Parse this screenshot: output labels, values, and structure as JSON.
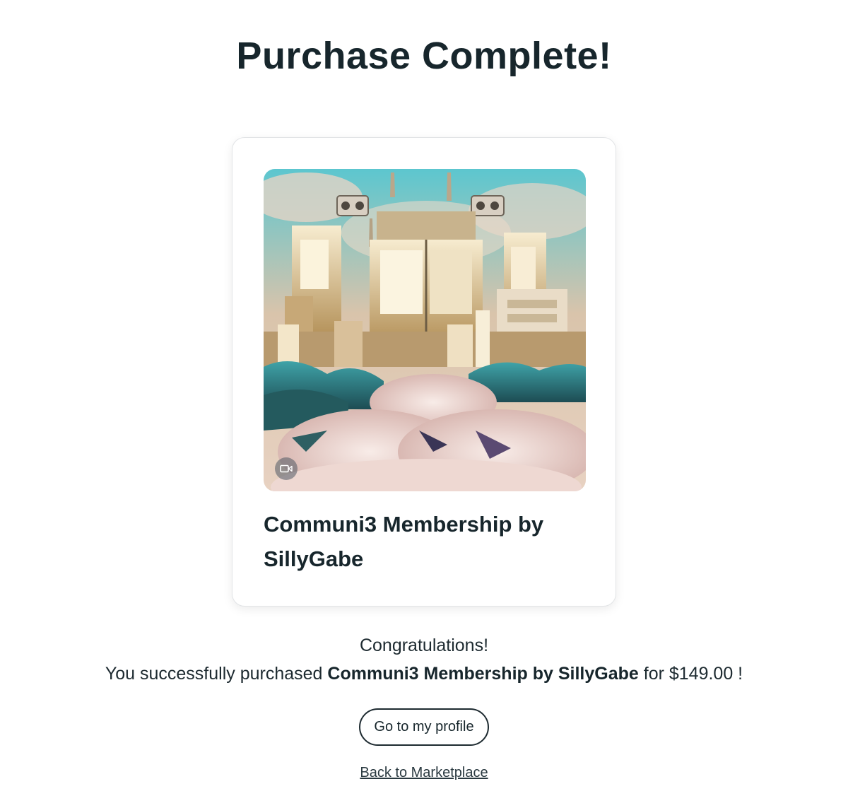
{
  "page": {
    "title": "Purchase Complete!"
  },
  "card": {
    "title": "Communi3 Membership by SillyGabe",
    "media_type": "video",
    "media_icon": "video-camera-icon"
  },
  "message": {
    "congrats": "Congratulations!",
    "prefix": "You successfully purchased",
    "item_name": "Communi3 Membership by SillyGabe",
    "price_text": "for $149.00 !"
  },
  "actions": {
    "profile_button_label": "Go to my profile",
    "back_link_label": "Back to Marketplace"
  },
  "colors": {
    "text": "#17262c",
    "button_border": "#1d2a30",
    "card_border": "#e2e4e6"
  }
}
